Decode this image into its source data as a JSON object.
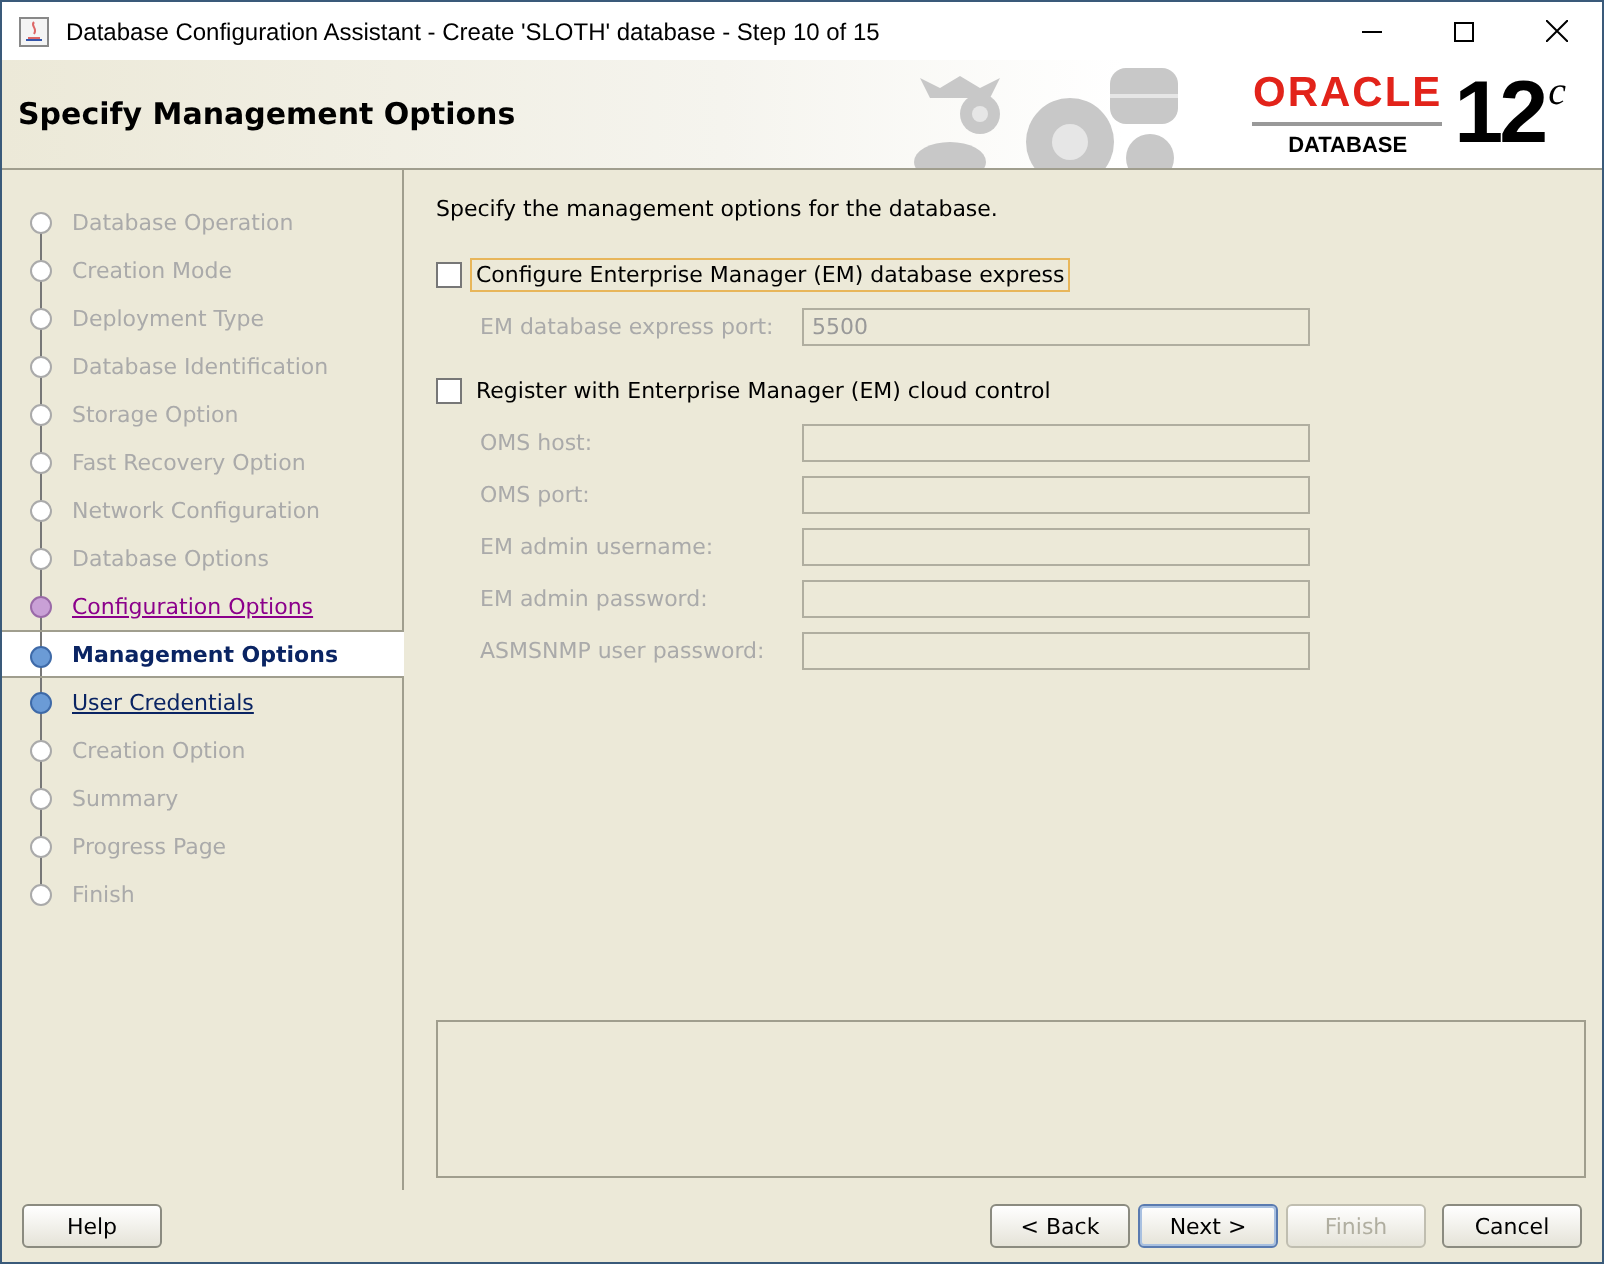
{
  "window": {
    "title": "Database Configuration Assistant - Create 'SLOTH' database - Step 10 of 15"
  },
  "header": {
    "title": "Specify Management Options",
    "logo": {
      "brand": "ORACLE",
      "product": "DATABASE",
      "version": "12",
      "version_suffix": "c"
    }
  },
  "steps": [
    {
      "label": "Database Operation",
      "selected": false,
      "link": false,
      "visited": false
    },
    {
      "label": "Creation Mode",
      "selected": false,
      "link": false,
      "visited": false
    },
    {
      "label": "Deployment Type",
      "selected": false,
      "link": false,
      "visited": false
    },
    {
      "label": "Database Identification",
      "selected": false,
      "link": false,
      "visited": false
    },
    {
      "label": "Storage Option",
      "selected": false,
      "link": false,
      "visited": false
    },
    {
      "label": "Fast Recovery Option",
      "selected": false,
      "link": false,
      "visited": false
    },
    {
      "label": "Network Configuration",
      "selected": false,
      "link": false,
      "visited": false
    },
    {
      "label": "Database Options",
      "selected": false,
      "link": false,
      "visited": false
    },
    {
      "label": "Configuration Options",
      "selected": false,
      "link": true,
      "visited": true
    },
    {
      "label": "Management Options",
      "selected": true,
      "link": false,
      "visited": false
    },
    {
      "label": "User Credentials",
      "selected": false,
      "link": true,
      "visited": false
    },
    {
      "label": "Creation Option",
      "selected": false,
      "link": false,
      "visited": false
    },
    {
      "label": "Summary",
      "selected": false,
      "link": false,
      "visited": false
    },
    {
      "label": "Progress Page",
      "selected": false,
      "link": false,
      "visited": false
    },
    {
      "label": "Finish",
      "selected": false,
      "link": false,
      "visited": false
    }
  ],
  "content": {
    "intro": "Specify the management options for the database.",
    "options": [
      {
        "label": "Configure Enterprise Manager (EM) database express",
        "checked": false,
        "focused": true,
        "fields": [
          {
            "label": "EM database express port:",
            "value": "5500",
            "disabled": true
          }
        ]
      },
      {
        "label": "Register with Enterprise Manager (EM) cloud control",
        "checked": false,
        "focused": false,
        "fields": [
          {
            "label": "OMS host:",
            "disabled": true
          },
          {
            "label": "OMS port:",
            "disabled": true
          },
          {
            "label": "EM admin username:",
            "disabled": true
          },
          {
            "label": "EM admin password:",
            "disabled": true
          },
          {
            "label": "ASMSNMP user password:",
            "disabled": true
          }
        ]
      }
    ]
  },
  "buttons": [
    {
      "label": "Help",
      "kind": "help",
      "disabled": false,
      "default": false
    },
    {
      "label": "< Back",
      "kind": "nav",
      "disabled": false,
      "default": false
    },
    {
      "label": "Next >",
      "kind": "nav",
      "disabled": false,
      "default": true
    },
    {
      "label": "Finish",
      "kind": "nav",
      "disabled": true,
      "default": false
    },
    {
      "label": "Cancel",
      "kind": "cancel",
      "disabled": false,
      "default": false
    }
  ]
}
